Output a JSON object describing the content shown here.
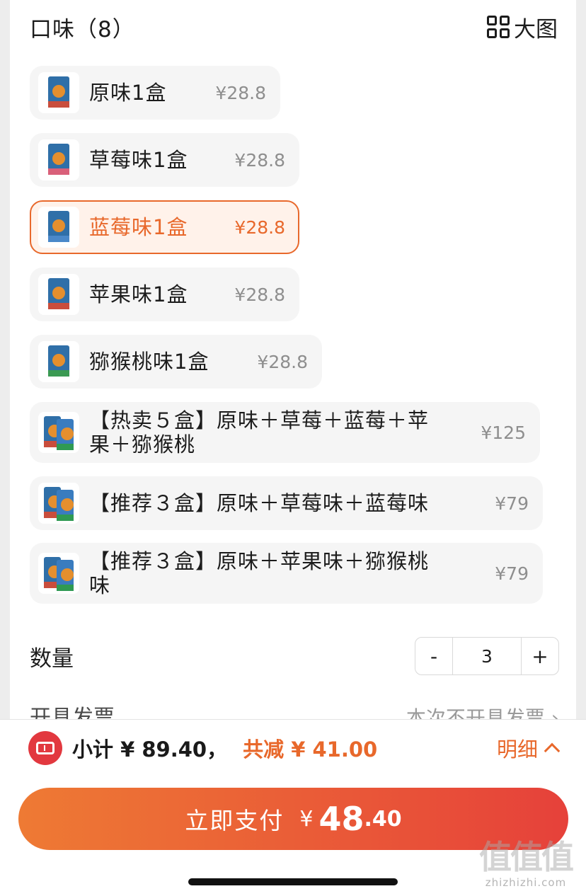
{
  "header": {
    "title": "口味（8）",
    "big_view_label": "大图",
    "big_view_icon": "grid-icon"
  },
  "options": [
    {
      "label": "原味1盒",
      "price": "¥28.8",
      "selected": false
    },
    {
      "label": "草莓味1盒",
      "price": "¥28.8",
      "selected": false
    },
    {
      "label": "蓝莓味1盒",
      "price": "¥28.8",
      "selected": true
    },
    {
      "label": "苹果味1盒",
      "price": "¥28.8",
      "selected": false
    },
    {
      "label": "猕猴桃味1盒",
      "price": "¥28.8",
      "selected": false
    },
    {
      "label": "【热卖５盒】原味＋草莓＋蓝莓＋苹果＋猕猴桃",
      "price": "¥125",
      "selected": false
    },
    {
      "label": "【推荐３盒】原味＋草莓味＋蓝莓味",
      "price": "¥79",
      "selected": false
    },
    {
      "label": "【推荐３盒】原味＋苹果味＋猕猴桃味",
      "price": "¥79",
      "selected": false
    }
  ],
  "quantity": {
    "label": "数量",
    "minus": "-",
    "value": "3",
    "plus": "+"
  },
  "invoice_row": {
    "label": "开具发票",
    "value": "本次不开具发票 ›"
  },
  "summary": {
    "subtotal": "小计 ¥ 89.40，",
    "discount": "共减 ¥ 41.00",
    "detail_label": "明细"
  },
  "pay": {
    "label": "立即支付",
    "currency": "¥",
    "amount_int": "48",
    "amount_dec": ".40"
  },
  "watermark": {
    "main": "值值值",
    "sub": "zhizhizhi.com"
  },
  "colors": {
    "accent": "#e8682b",
    "coupon": "#e2383f",
    "pay_gradient_start": "#ee7a34",
    "pay_gradient_end": "#e6413a"
  }
}
